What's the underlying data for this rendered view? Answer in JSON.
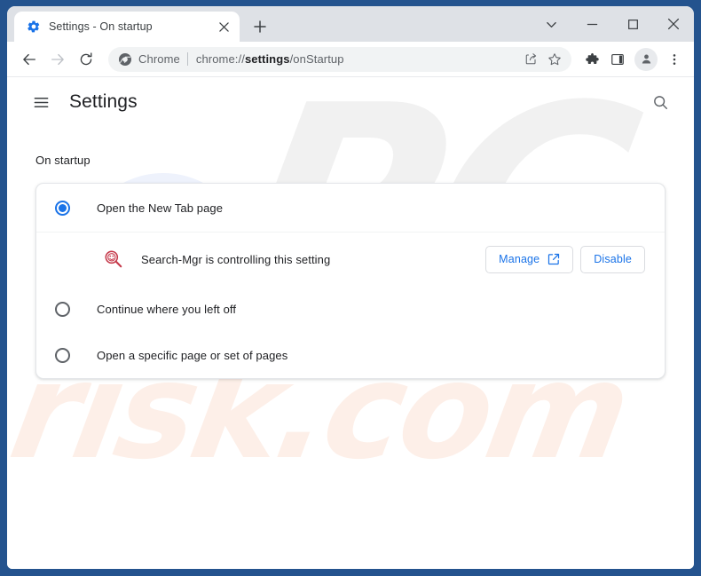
{
  "window": {
    "frame_color": "#24538e",
    "controls": [
      {
        "name": "tab-search-button",
        "icon": "chevron-down-icon",
        "label": ""
      },
      {
        "name": "minimize-button",
        "icon": "minimize-icon",
        "label": ""
      },
      {
        "name": "maximize-button",
        "icon": "maximize-icon",
        "label": ""
      },
      {
        "name": "close-button",
        "icon": "close-icon",
        "label": ""
      }
    ]
  },
  "tab_strip": {
    "active_tab": {
      "favicon": "settings-gear-favicon",
      "title": "Settings - On startup",
      "close_icon": "close-icon"
    },
    "new_tab_icon": "plus-icon"
  },
  "toolbar": {
    "back_icon": "back-arrow-icon",
    "forward_icon": "forward-arrow-icon",
    "reload_icon": "reload-icon",
    "omnibox": {
      "chip_icon": "chrome-logo-icon",
      "chip_label": "Chrome",
      "url_prefix": "chrome://",
      "url_bold": "settings",
      "url_suffix": "/onStartup",
      "full_url": "chrome://settings/onStartup",
      "share_icon": "share-icon",
      "bookmark_icon": "bookmark-star-icon"
    },
    "extensions_icon": "puzzle-piece-icon",
    "side_panel_icon": "side-panel-icon",
    "profile_icon": "profile-avatar-icon",
    "menu_icon": "three-dot-menu-icon"
  },
  "settings": {
    "hamburger_icon": "hamburger-menu-icon",
    "title": "Settings",
    "search_icon": "search-icon",
    "section_label": "On startup",
    "options": [
      {
        "label": "Open the New Tab page",
        "selected": true
      },
      {
        "label": "Continue where you left off",
        "selected": false
      },
      {
        "label": "Open a specific page or set of pages",
        "selected": false
      }
    ],
    "controlled_by": {
      "extension_icon": "search-mgr-magnifier-icon",
      "text": "Search-Mgr is controlling this setting",
      "manage_label": "Manage",
      "manage_icon": "external-link-icon",
      "disable_label": "Disable"
    },
    "accent_color": "#1a73e8",
    "extension_icon_color": "#c5394a"
  },
  "watermark": {
    "text_primary": "PC",
    "text_secondary": "risk.com"
  }
}
